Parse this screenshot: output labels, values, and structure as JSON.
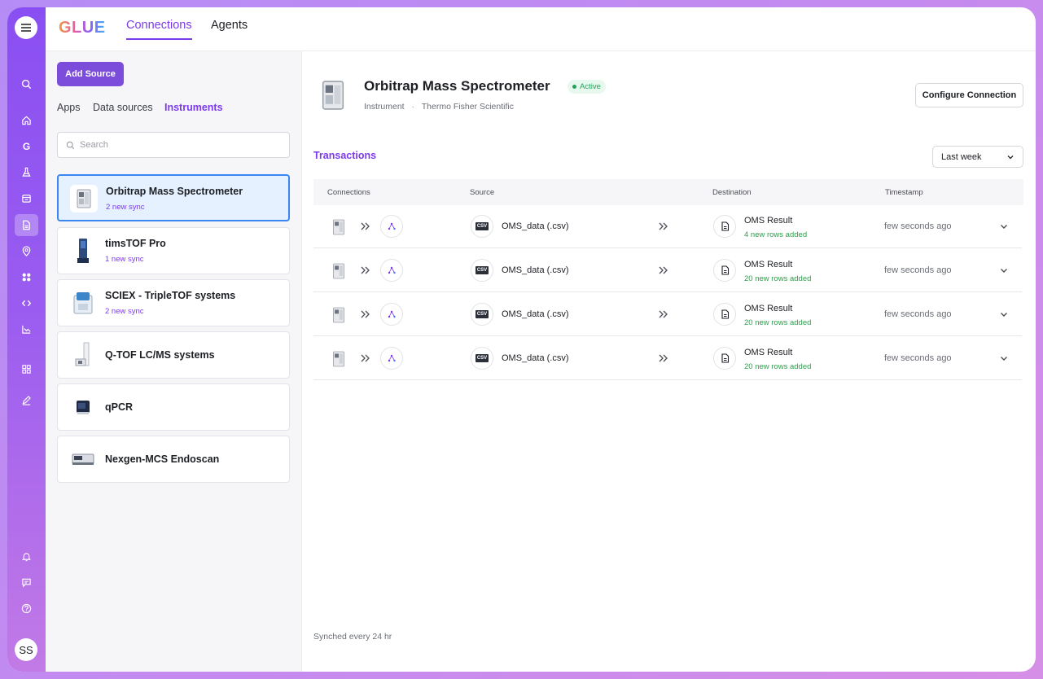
{
  "app": {
    "logo": "GLUE"
  },
  "nav": {
    "tabs": [
      {
        "label": "Connections"
      },
      {
        "label": "Agents"
      }
    ]
  },
  "user": {
    "initials": "SS"
  },
  "rail": {
    "icons": [
      "search-icon",
      "home-icon",
      "g-icon",
      "flask-icon",
      "store-icon",
      "document-icon",
      "location-pin-icon",
      "apps-icon",
      "code-icon",
      "chart-icon",
      "grid-icon",
      "pen-icon",
      "bell-icon",
      "chat-icon",
      "help-icon"
    ]
  },
  "sidebar": {
    "add_source_label": "Add Source",
    "tabs": [
      {
        "label": "Apps"
      },
      {
        "label": "Data sources"
      },
      {
        "label": "Instruments"
      }
    ],
    "search_placeholder": "Search",
    "instruments": [
      {
        "name": "Orbitrap Mass Spectrometer",
        "sync": "2 new sync"
      },
      {
        "name": "timsTOF Pro",
        "sync": "1 new sync"
      },
      {
        "name": "SCIEX - TripleTOF systems",
        "sync": "2 new sync"
      },
      {
        "name": "Q-TOF LC/MS systems",
        "sync": ""
      },
      {
        "name": "qPCR",
        "sync": ""
      },
      {
        "name": "Nexgen-MCS Endoscan",
        "sync": ""
      }
    ]
  },
  "detail": {
    "title": "Orbitrap Mass Spectrometer",
    "status": "Active",
    "type": "Instrument",
    "vendor": "Thermo Fisher Scientific",
    "meta_separator": "·",
    "configure_label": "Configure Connection",
    "transactions_label": "Transactions",
    "period": "Last week",
    "columns": {
      "connections": "Connections",
      "source": "Source",
      "destination": "Destination",
      "timestamp": "Timestamp"
    },
    "rows": [
      {
        "source": "OMS_data (.csv)",
        "source_badge": "CSV",
        "destination": "OMS Result",
        "rows_added": "4 new rows added",
        "timestamp": "few seconds ago"
      },
      {
        "source": "OMS_data (.csv)",
        "source_badge": "CSV",
        "destination": "OMS Result",
        "rows_added": "20 new rows added",
        "timestamp": "few seconds ago"
      },
      {
        "source": "OMS_data (.csv)",
        "source_badge": "CSV",
        "destination": "OMS Result",
        "rows_added": "20 new rows added",
        "timestamp": "few seconds ago"
      },
      {
        "source": "OMS_data (.csv)",
        "source_badge": "CSV",
        "destination": "OMS Result",
        "rows_added": "20 new rows added",
        "timestamp": "few seconds ago"
      }
    ],
    "sync_note": "Synched every 24 hr"
  },
  "colors": {
    "accent": "#7c3aed",
    "button": "#7c4dda",
    "active_green": "#22a35a",
    "selected_border": "#3a86f0"
  }
}
